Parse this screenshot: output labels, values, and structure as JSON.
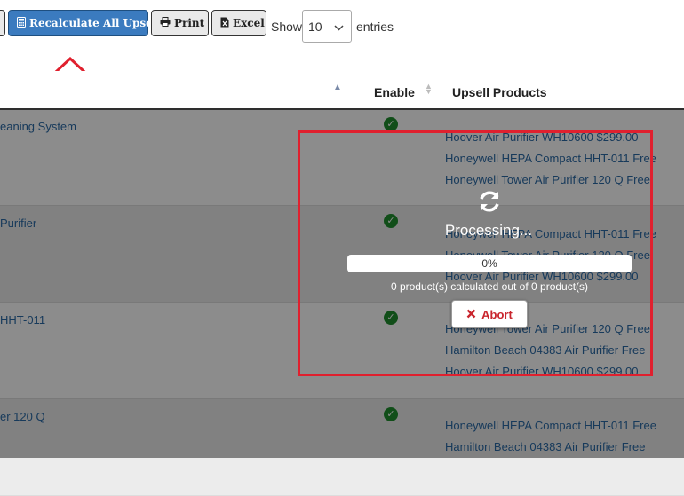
{
  "toolbar": {
    "recalc_label": "Recalculate All Upsells",
    "print_label": "Print",
    "excel_label": "Excel",
    "show_label": "Show",
    "entries_value": "10",
    "entries_label": "entries"
  },
  "table": {
    "headers": {
      "enable": "Enable",
      "upsells": "Upsell Products"
    },
    "rows": [
      {
        "name": "eaning System",
        "upsells": [
          "Hoover Air Purifier WH10600 $299.00",
          "Honeywell HEPA Compact HHT-011 Free",
          "Honeywell Tower Air Purifier 120 Q Free"
        ]
      },
      {
        "name": "Purifier",
        "upsells": [
          "Honeywell HEPA Compact HHT-011 Free",
          "Honeywell Tower Air Purifier 120 Q Free",
          "Hoover Air Purifier WH10600 $299.00"
        ]
      },
      {
        "name": "HHT-011",
        "upsells": [
          "Honeywell Tower Air Purifier 120 Q Free",
          "Hamilton Beach 04383 Air Purifier Free",
          "Hoover Air Purifier WH10600 $299.00"
        ]
      },
      {
        "name": "er 120 Q",
        "upsells": [
          "Honeywell HEPA Compact HHT-011 Free",
          "Hamilton Beach 04383 Air Purifier Free"
        ]
      }
    ]
  },
  "processing": {
    "title": "Processing...",
    "progress_percent": 0,
    "progress_label": "0%",
    "count_text": "0 product(s) calculated out of 0 product(s)",
    "abort_label": "Abort"
  },
  "colors": {
    "primary": "#3b7bbf",
    "link": "#2b6aa6",
    "highlight": "#e0202e",
    "abort": "#c9252d"
  }
}
